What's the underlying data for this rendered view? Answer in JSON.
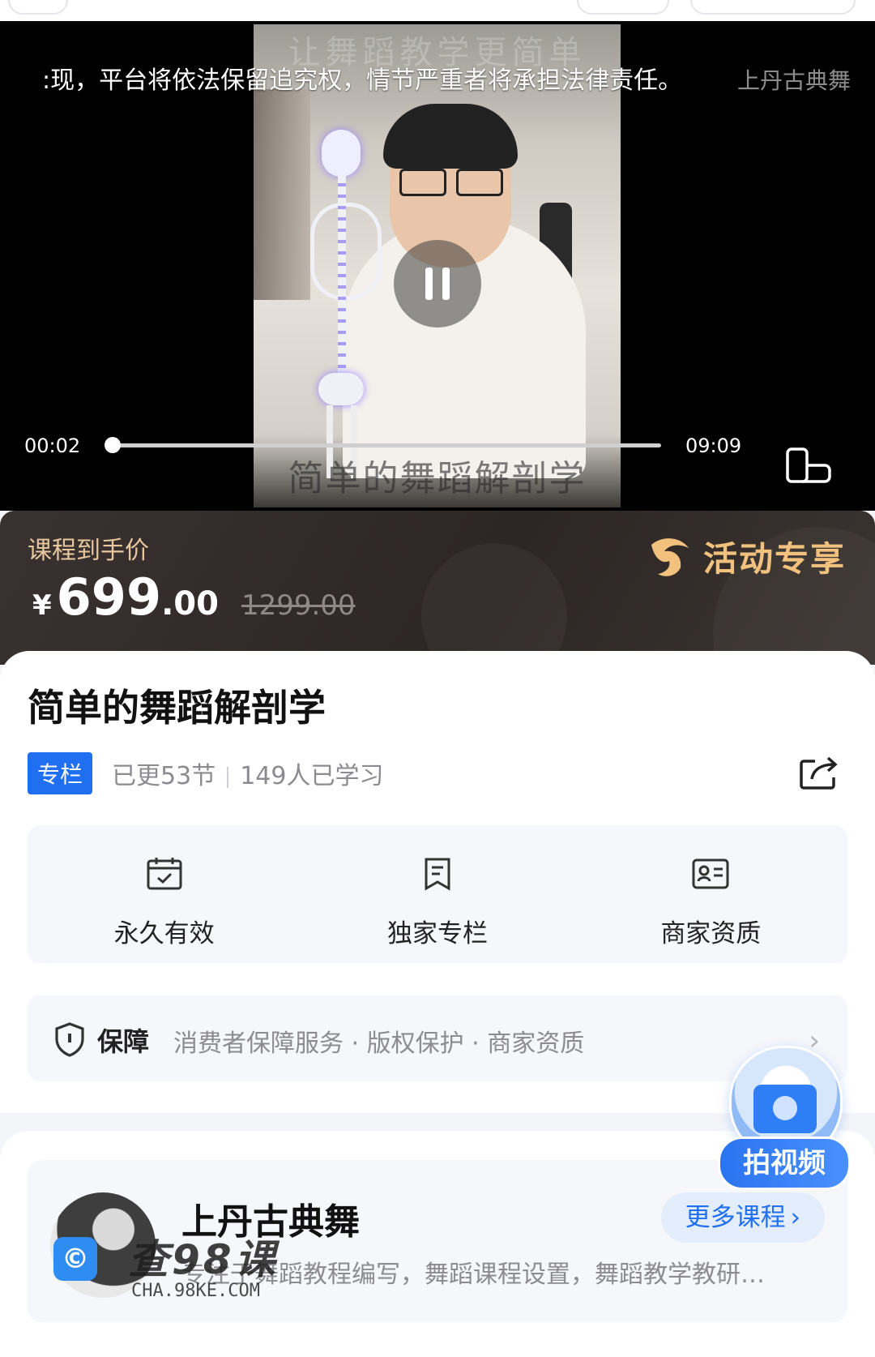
{
  "video": {
    "marquee_text": ":现，平台将依法保留追究权，情节严重者将承担法律责任。",
    "marquee_brand": "上丹古典舞",
    "frame_watermark_top": "让舞蹈教学更简单",
    "frame_watermark_bottom": "简单的舞蹈解剖学",
    "current_time": "00:02",
    "duration": "09:09",
    "progress_fraction": 0.004
  },
  "price": {
    "label": "课程到手价",
    "currency": "¥",
    "integer": "699",
    "decimal": ".00",
    "original": "1299.00",
    "promo_label": "活动专享"
  },
  "course": {
    "title": "简单的舞蹈解剖学",
    "tag": "专栏",
    "updated": "已更53节",
    "learners": "149人已学习"
  },
  "features": [
    {
      "label": "永久有效",
      "icon": "calendar-check-icon"
    },
    {
      "label": "独家专栏",
      "icon": "bookmark-icon"
    },
    {
      "label": "商家资质",
      "icon": "id-card-icon"
    }
  ],
  "guarantee": {
    "title": "保障",
    "items": "消费者保障服务 · 版权保护 · 商家资质"
  },
  "merchant": {
    "name": "上丹古典舞",
    "description": "专注于舞蹈教程编写，舞蹈课程设置，舞蹈教学教研…",
    "more_button": "更多课程"
  },
  "float_widget": {
    "label": "拍视频"
  },
  "watermark": {
    "big": "查98课",
    "small": "CHA.98KE.COM"
  },
  "colors": {
    "accent": "#1f6ff0",
    "price_band": "#2c2624",
    "promo_gold": "#f1c17d",
    "label_gold": "#e9c8a0"
  }
}
